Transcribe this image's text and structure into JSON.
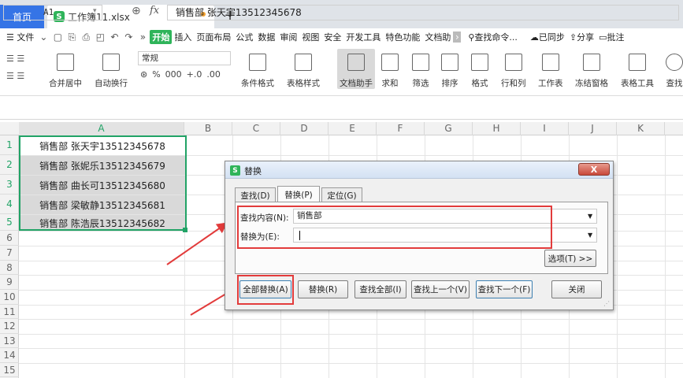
{
  "tabs": {
    "home": "首页",
    "file": "工作簿11.xlsx",
    "new_tab_glyph": "+"
  },
  "menu": {
    "file": "☰ 文件",
    "items": [
      "开始",
      "插入",
      "页面布局",
      "公式",
      "数据",
      "审阅",
      "视图",
      "安全",
      "开发工具",
      "特色功能",
      "文档助"
    ],
    "search": "查找命令...",
    "sync": "已同步",
    "share": "分享",
    "annot": "批注"
  },
  "ribbon": {
    "merge": "合并居中",
    "wrap": "自动换行",
    "number_format": "常规",
    "cond_format": "条件格式",
    "table_style": "表格样式",
    "doc_helper": "文档助手",
    "sum": "求和",
    "filter": "筛选",
    "sort": "排序",
    "format": "格式",
    "rowcol": "行和列",
    "sheet": "工作表",
    "freeze": "冻结窗格",
    "table_tools": "表格工具",
    "find": "查找",
    "symbols": [
      "%",
      "000",
      "+.0",
      ".00"
    ]
  },
  "formula_bar": {
    "cell_ref": "A1",
    "fx": "fx",
    "value": "销售部 张天宇13512345678"
  },
  "grid": {
    "columns": [
      "A",
      "B",
      "C",
      "D",
      "E",
      "F",
      "G",
      "H",
      "I",
      "J",
      "K"
    ],
    "rows": [
      "1",
      "2",
      "3",
      "4",
      "5",
      "6",
      "7",
      "8",
      "9",
      "10",
      "11",
      "12",
      "13",
      "14",
      "15"
    ],
    "cells": [
      "销售部 张天宇13512345678",
      "销售部 张妮乐13512345679",
      "销售部 曲长可13512345680",
      "销售部 梁敏静13512345681",
      "销售部 陈浩辰13512345682"
    ]
  },
  "dialog": {
    "title": "替换",
    "close_glyph": "X",
    "tabs": [
      "查找(D)",
      "替换(P)",
      "定位(G)"
    ],
    "find_label": "查找内容(N):",
    "find_value": "销售部",
    "replace_label": "替换为(E):",
    "replace_value": "",
    "options_btn": "选项(T) >>",
    "buttons": [
      "全部替换(A)",
      "替换(R)",
      "查找全部(I)",
      "查找上一个(V)",
      "查找下一个(F)",
      "关闭"
    ]
  },
  "colors": {
    "accent": "#3574e6",
    "green": "#21a366",
    "highlight": "#e23b3b"
  }
}
